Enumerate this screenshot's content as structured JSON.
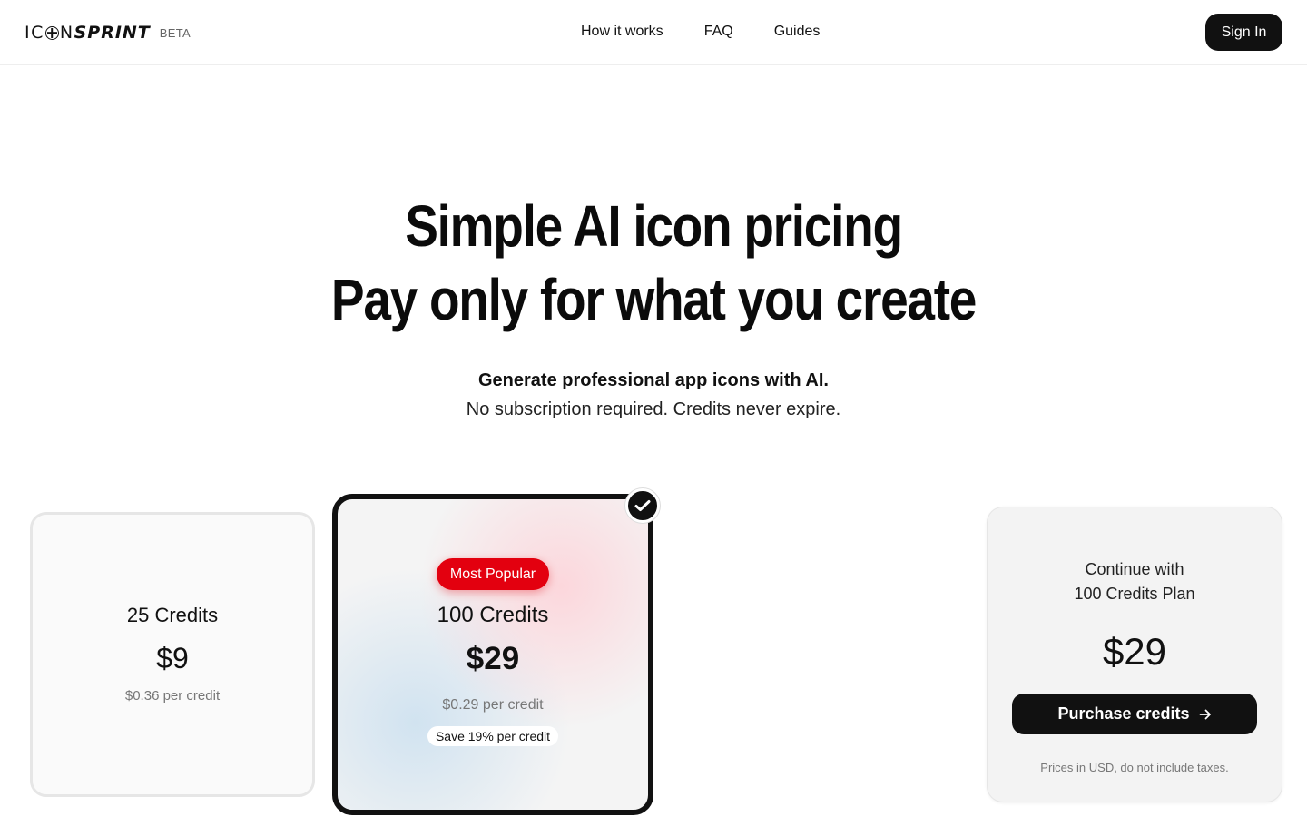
{
  "header": {
    "logo_light": "IC",
    "logo_light_2": "N",
    "logo_bold": "SPRINT",
    "beta": "BETA",
    "nav": [
      "How it works",
      "FAQ",
      "Guides"
    ],
    "signin_label": "Sign In"
  },
  "hero": {
    "title_line1": "Simple AI icon pricing",
    "title_line2": "Pay only for what you create",
    "subtitle_bold": "Generate professional app icons with AI.",
    "subtitle": "No subscription required. Credits never expire."
  },
  "plans": [
    {
      "credits": "25 Credits",
      "price": "$9",
      "per_credit": "$0.36 per credit"
    },
    {
      "badge": "Most Popular",
      "credits": "100 Credits",
      "price": "$29",
      "per_credit": "$0.29 per credit",
      "savings": "Save 19% per credit",
      "selected": true
    }
  ],
  "checkout": {
    "continue_line1": "Continue with",
    "continue_line2": "100 Credits Plan",
    "price": "$29",
    "button_label": "Purchase credits",
    "tax_note": "Prices in USD, do not include taxes."
  },
  "colors": {
    "accent_red": "#e3000f",
    "primary_dark": "#111111"
  },
  "icons": {
    "selected": "check-icon",
    "purchase": "arrow-right-icon"
  }
}
